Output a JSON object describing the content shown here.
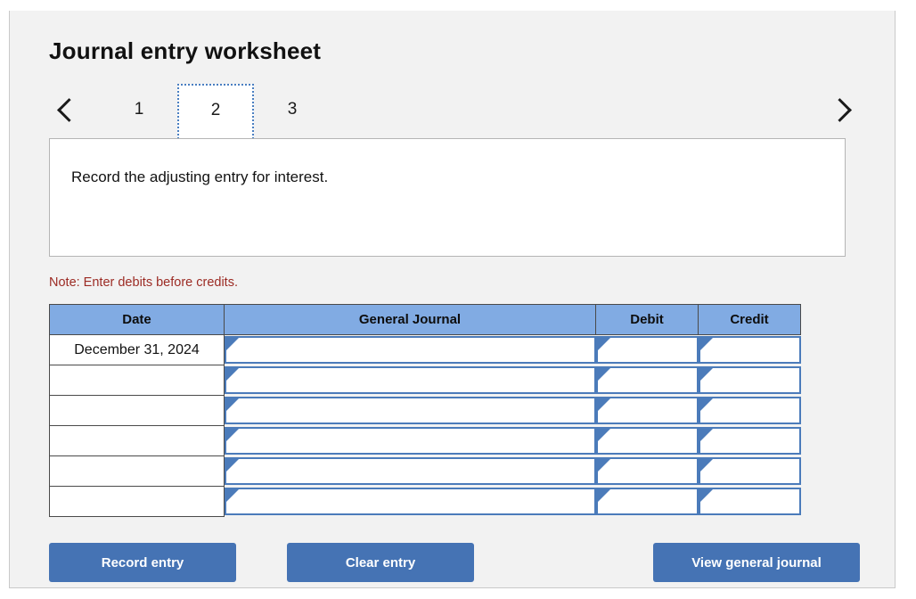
{
  "page": {
    "title": "Journal entry worksheet"
  },
  "pager": {
    "prev_icon": "chevron-left-icon",
    "next_icon": "chevron-right-icon",
    "tabs": [
      {
        "label": "1",
        "active": false
      },
      {
        "label": "2",
        "active": true
      },
      {
        "label": "3",
        "active": false
      }
    ]
  },
  "instruction": {
    "text": "Record the adjusting entry for interest."
  },
  "note": {
    "text": "Note: Enter debits before credits."
  },
  "table": {
    "headers": [
      "Date",
      "General Journal",
      "Debit",
      "Credit"
    ],
    "rows": [
      {
        "date": "December 31, 2024",
        "general_journal": "",
        "debit": "",
        "credit": ""
      },
      {
        "date": "",
        "general_journal": "",
        "debit": "",
        "credit": ""
      },
      {
        "date": "",
        "general_journal": "",
        "debit": "",
        "credit": ""
      },
      {
        "date": "",
        "general_journal": "",
        "debit": "",
        "credit": ""
      },
      {
        "date": "",
        "general_journal": "",
        "debit": "",
        "credit": ""
      },
      {
        "date": "",
        "general_journal": "",
        "debit": "",
        "credit": ""
      }
    ]
  },
  "buttons": {
    "record": "Record entry",
    "clear": "Clear entry",
    "view": "View general journal"
  },
  "colors": {
    "header_blue": "#81abe3",
    "button_blue": "#4573b4",
    "field_border_blue": "#4b7bba",
    "note_red": "#9c2b24",
    "card_background": "#f2f2f2"
  }
}
